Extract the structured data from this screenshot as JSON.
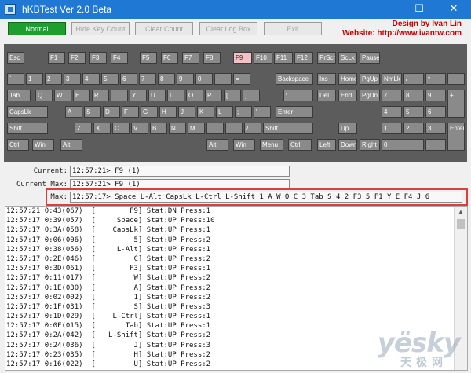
{
  "window": {
    "title": "hKBTest Ver 2.0 Beta",
    "controls": {
      "minimize": "—",
      "maximize": "☐",
      "close": "✕"
    }
  },
  "toolbar": [
    {
      "id": "normal",
      "label": "Normal",
      "active": true
    },
    {
      "id": "hide-key-count",
      "label": "Hide Key Count",
      "active": false
    },
    {
      "id": "clear-count",
      "label": "Clear Count",
      "active": false
    },
    {
      "id": "clear-log-box",
      "label": "Clear Log Box",
      "active": false
    },
    {
      "id": "exit",
      "label": "Exit",
      "active": false
    }
  ],
  "credits": {
    "design": "Design by Ivan Lin",
    "website": "Website: http://www.ivantw.com"
  },
  "colors": {
    "title_bar": "#1f79d4",
    "active_button": "#1e9e2e",
    "credits_text": "#c80000",
    "keyboard_bg": "#5c5c5c",
    "key": "#8a8a8a",
    "pressed_key": "#f6bfc6",
    "highlight_box": "#e23b3b"
  },
  "keyboard": {
    "keys": [
      "Esc",
      "F1",
      "F2",
      "F3",
      "F4",
      "F5",
      "F6",
      "F7",
      "F8",
      "F9",
      "F10",
      "F11",
      "F12",
      "PrScr",
      "ScLk",
      "Pause",
      "`",
      "1",
      "2",
      "3",
      "4",
      "5",
      "6",
      "7",
      "8",
      "9",
      "0",
      "-",
      "=",
      "Backspace",
      "Ins",
      "Home",
      "PgUp",
      "NmLk",
      "/",
      "*",
      "-",
      "Tab",
      "Q",
      "W",
      "E",
      "R",
      "T",
      "Y",
      "U",
      "I",
      "O",
      "P",
      "[",
      "]",
      "\\",
      "Del",
      "End",
      "PgDn",
      "7",
      "8",
      "9",
      "+",
      "CapsLk",
      "A",
      "S",
      "D",
      "F",
      "G",
      "H",
      "J",
      "K",
      "L",
      ";",
      "'",
      "Enter",
      "4",
      "5",
      "6",
      "Shift",
      "Z",
      "X",
      "C",
      "V",
      "B",
      "N",
      "M",
      ",",
      ".",
      "/",
      "Shift",
      "Up",
      "1",
      "2",
      "3",
      "Enter",
      "Ctrl",
      "Win",
      "Alt",
      "Alt",
      "Win",
      "Menu",
      "Ctrl",
      "Left",
      "Down",
      "Right",
      "0",
      "."
    ],
    "pressed": "F9"
  },
  "status": {
    "current_label": "Current:",
    "current_value": "12:57:21> F9 (1)",
    "current_max_label": "Current Max:",
    "current_max_value": "12:57:21> F9 (1)",
    "max_label": "Max:",
    "max_value": "12:57:17> Space L-Alt CapsLk L-Ctrl L-Shift 1 A W Q C 3 Tab S 4 2 F3 5 F1 Y E F4 J 6"
  },
  "log": [
    "12:57:21 0:43(067)  [        F9] Stat:DN Press:1",
    "12:57:17 0:39(057)  [     Space] Stat:UP Press:10",
    "12:57:17 0:3A(058)  [    CapsLk] Stat:UP Press:1",
    "12:57:17 0:06(006)  [         5] Stat:UP Press:2",
    "12:57:17 0:38(056)  [     L-Alt] Stat:UP Press:1",
    "12:57:17 0:2E(046)  [         C] Stat:UP Press:2",
    "12:57:17 0:3D(061)  [        F3] Stat:UP Press:1",
    "12:57:17 0:11(017)  [         W] Stat:UP Press:2",
    "12:57:17 0:1E(030)  [         A] Stat:UP Press:2",
    "12:57:17 0:02(002)  [         1] Stat:UP Press:2",
    "12:57:17 0:1F(031)  [         S] Stat:UP Press:3",
    "12:57:17 0:1D(029)  [    L-Ctrl] Stat:UP Press:1",
    "12:57:17 0:0F(015)  [       Tab] Stat:UP Press:1",
    "12:57:17 0:2A(042)  [   L-Shift] Stat:UP Press:2",
    "12:57:17 0:24(036)  [         J] Stat:UP Press:3",
    "12:57:17 0:23(035)  [         H] Stat:UP Press:2",
    "12:57:17 0:16(022)  [         U] Stat:UP Press:2"
  ],
  "watermark": {
    "text": "yesky",
    "sub": "天极网"
  }
}
